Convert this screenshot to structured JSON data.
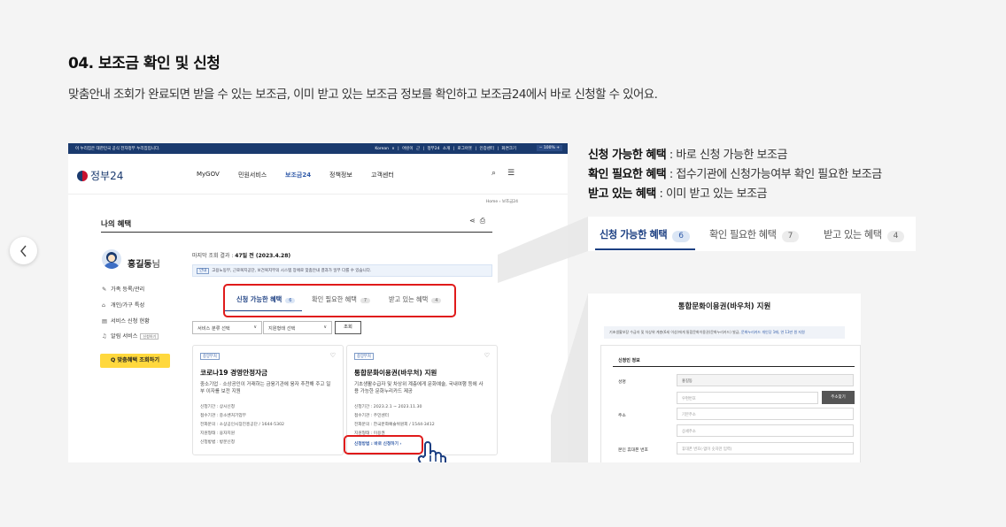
{
  "section": {
    "title": "04. 보조금 확인 및 신청",
    "description": "맞춤안내 조회가 완료되면 받을 수 있는 보조금, 이미 받고 있는 보조금 정보를 확인하고 보조금24에서 바로 신청할 수 있어요."
  },
  "carousel": {
    "prev_icon": "chevron-left-icon"
  },
  "screenshot": {
    "topbar": {
      "gov_notice": "이 누리집은 대한민국 공식 전자정부 누리집입니다.",
      "links": "Korean ∨ | 어린이 근 | 정부24 소개 | 로그아웃 | 인증센터 | 화면크기",
      "zoom": "−  100%  +"
    },
    "logo": "정부24",
    "menu": [
      "MyGOV",
      "민원서비스",
      "보조금24",
      "정책정보",
      "고객센터"
    ],
    "active_menu": "보조금24",
    "breadcrumb": "Home  ›  보조금24",
    "page_title": "나의 혜택",
    "user": {
      "name": "홍길동",
      "suffix": "님"
    },
    "sidebar": [
      {
        "icon": "pencil-icon",
        "glyph": "✎",
        "label": "가족 등록/관리"
      },
      {
        "icon": "house-icon",
        "glyph": "⌂",
        "label": "개인/가구 특성"
      },
      {
        "icon": "document-icon",
        "glyph": "▤",
        "label": "서비스 신청 현황"
      },
      {
        "icon": "bell-icon",
        "glyph": "♫",
        "label": "알림 서비스",
        "tag": "신청하기"
      }
    ],
    "lookup_button": "Q 맞춤혜택 조회하기",
    "last_result_label": "마지막 조회 결과 : ",
    "last_result_value": "47일 전 (2023.4.28)",
    "notice_tag": "안내",
    "notice_text": "고용노동부, 근로복지공단, 보건복지부의 시스템 장애로 맞춤안내 결과가 일부 다를 수 있습니다.",
    "tabs": [
      {
        "label": "신청 가능한 혜택",
        "count": "6"
      },
      {
        "label": "확인 필요한 혜택",
        "count": "7"
      },
      {
        "label": "받고 있는 혜택",
        "count": "4"
      }
    ],
    "filters": {
      "category": "서비스 분류 선택",
      "support": "지원형태 선택",
      "search": "조회"
    },
    "cards": [
      {
        "badge": "중앙부처",
        "title": "코로나19 경영안정자금",
        "desc": "중소기업 · 소상공인이 거래하는 금융기관에 융자 추천해 주고 일부 이자를 보전 지원",
        "info": [
          "신청기간 : 상시신청",
          "접수기관 : 중소벤처기업부",
          "전화문의 : 소상공인시장진흥공단 / 1644-5302",
          "지원형태 : 융자지원",
          "신청방법 : 방문신청"
        ]
      },
      {
        "badge": "중앙부처",
        "title": "통합문화이용권(바우처) 지원",
        "desc": "기초생활수급자 및 차상위 계층에게 문화예술, 국내여행 등에 사용 가능한 문화누리카드 제공",
        "info": [
          "신청기간 : 2023.2.1 ~ 2023.11.30",
          "접수기관 : 주민센터",
          "전화문의 : 한국문화예술위원회 / 1544-3412",
          "지원형태 : 이용권",
          "신청방법 : 바로 신청하기 ›"
        ]
      }
    ]
  },
  "legend": [
    {
      "term": "신청 가능한 혜택",
      "desc": " : 바로 신청 가능한 보조금"
    },
    {
      "term": "확인 필요한 혜택",
      "desc": " : 접수기관에 신청가능여부 확인 필요한 보조금"
    },
    {
      "term": "받고 있는 혜택",
      "desc": " : 이미 받고 있는 보조금"
    }
  ],
  "zoom_tabs": [
    {
      "label": "신청 가능한 혜택",
      "count": "6"
    },
    {
      "label": "확인 필요한 혜택",
      "count": "7"
    },
    {
      "label": "받고 있는 혜택",
      "count": "4"
    }
  ],
  "detail": {
    "title": "통합문화이용권(바우처) 지원",
    "notice": "기초생활보장 수급자 및 차상위 계층(6세 이상)에게 통합문화이용권(문화누리카드) 발급, ",
    "notice_link": "문화누리카드 개인당 1매, 연 13만 원 지원",
    "section": "신청인 정보",
    "fields": [
      {
        "label": "성명",
        "value": "홍길동"
      },
      {
        "label": "주소",
        "placeholder1": "우편번호",
        "placeholder2": "기본주소",
        "placeholder3": "상세주소",
        "button": "주소찾기"
      },
      {
        "label": "본인 휴대폰 번호",
        "placeholder": "휴대폰 번호(-없이 숫자만 입력)"
      }
    ]
  },
  "colors": {
    "navy": "#1c3f82",
    "red_highlight": "#e01b1b",
    "yellow": "#ffd83d"
  }
}
